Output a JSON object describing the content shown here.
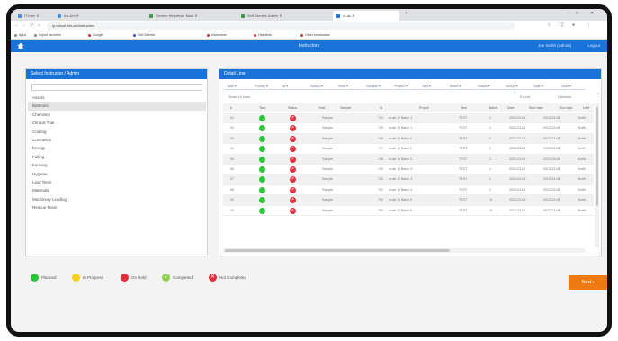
{
  "browser": {
    "tabs": [
      {
        "label": "IT.Instr",
        "color": "#4d8fd6",
        "active": false
      },
      {
        "label": "Ins.Arh",
        "color": "#4d8fd6",
        "active": false
      },
      {
        "label": "Service-Helpdesk: Main",
        "color": "#3c9a4a",
        "active": false
      },
      {
        "label": "Self-Service-Admin",
        "color": "#3c9a4a",
        "active": false
      },
      {
        "label": "eLab",
        "color": "#1a73d9",
        "active": true
      }
    ],
    "new_tab": "+",
    "window_controls": [
      "–",
      "□",
      "✕"
    ],
    "url": "ip.unical.it/eLab/instructors",
    "bookmarks": [
      {
        "label": "Apps",
        "color": "#888888"
      },
      {
        "label": "Import favorites",
        "color": "#888888"
      },
      {
        "label": "Google",
        "color": "#cc3333"
      },
      {
        "label": "Self-Service",
        "color": "#3355cc"
      },
      {
        "label": "Instructors",
        "color": "#cc3333"
      },
      {
        "label": "Helpdesk",
        "color": "#cc3333"
      },
      {
        "label": "Other bookmarks",
        "color": "#cc3333"
      }
    ]
  },
  "app": {
    "title": "Instructors",
    "user": "Joe Smith (Admin)",
    "logout": "Logout"
  },
  "left_panel": {
    "title": "Select Instructor / Admin",
    "select_placeholder": "",
    "items": [
      "Assets",
      "Batteries",
      "Chemistry",
      "Clinical Trial",
      "Coating",
      "Cosmetics",
      "Energy",
      "Falling",
      "Forming",
      "Hygiene",
      "Lipid Tests",
      "Materials",
      "Machinery Leading",
      "Rescue Team"
    ],
    "selected_index": 1
  },
  "right_panel": {
    "title": "Detail Line",
    "filters": [
      "Task",
      "Priority",
      "Id",
      "Status",
      "Hold",
      "Sample",
      "Project",
      "Test",
      "Batch",
      "Status",
      "Group",
      "Date",
      "User"
    ],
    "toolbar": [
      "Show 10 rows",
      "Export",
      "Columns"
    ],
    "columns": [
      "#",
      "Task",
      "Status",
      "Hold",
      "Sample",
      "Id",
      "Project",
      "Test",
      "Batch",
      "Date",
      "Start date",
      "End date",
      "User"
    ],
    "rows": [
      {
        "id": "01",
        "sample": "Sample",
        "num": "744",
        "project": "eLab 1 / Batch 1",
        "test": "TEST",
        "b": "1",
        "start": "2023-03-06",
        "end": "2023-03-08",
        "user": "Smith"
      },
      {
        "id": "02",
        "sample": "Sample",
        "num": "745",
        "project": "eLab 1 / Batch 1",
        "test": "TEST",
        "b": "1",
        "start": "2023-03-06",
        "end": "2023-03-08",
        "user": "Smith"
      },
      {
        "id": "03",
        "sample": "Sample",
        "num": "746",
        "project": "eLab 1 / Batch 2",
        "test": "TEST",
        "b": "1",
        "start": "2023-03-06",
        "end": "2023-03-08",
        "user": "Smith"
      },
      {
        "id": "04",
        "sample": "Sample",
        "num": "747",
        "project": "eLab 1 / Batch 2",
        "test": "TEST",
        "b": "1",
        "start": "2023-03-06",
        "end": "2023-03-08",
        "user": "Smith"
      },
      {
        "id": "05",
        "sample": "Sample",
        "num": "748",
        "project": "eLab 1 / Batch 3",
        "test": "TEST",
        "b": "1",
        "start": "2023-03-06",
        "end": "2023-03-08",
        "user": "Smith"
      },
      {
        "id": "06",
        "sample": "Sample",
        "num": "749",
        "project": "eLab 1 / Batch 3",
        "test": "TEST",
        "b": "1",
        "start": "2023-03-06",
        "end": "2023-03-08",
        "user": "Smith"
      },
      {
        "id": "07",
        "sample": "Sample",
        "num": "750",
        "project": "eLab 1 / Batch 4",
        "test": "TEST",
        "b": "1",
        "start": "2023-03-06",
        "end": "2023-03-08",
        "user": "Smith"
      },
      {
        "id": "08",
        "sample": "Sample",
        "num": "751",
        "project": "eLab 1 / Batch 4",
        "test": "TEST",
        "b": "1",
        "start": "2023-03-06",
        "end": "2023-03-08",
        "user": "Smith"
      },
      {
        "id": "09",
        "sample": "Sample",
        "num": "752",
        "project": "eLab 1 / Batch 5",
        "test": "TEST",
        "b": "11",
        "start": "2023-03-06",
        "end": "2023-03-08",
        "user": "Smith"
      },
      {
        "id": "10",
        "sample": "Sample",
        "num": "753",
        "project": "eLab 1 / Batch 5",
        "test": "TEST",
        "b": "11",
        "start": "2023-03-06",
        "end": "2023-03-08",
        "user": "Smith"
      }
    ]
  },
  "legend": [
    {
      "label": "Planned",
      "color": "#2ec43a",
      "glyph": ""
    },
    {
      "label": "In Progress",
      "color": "#f5d020",
      "glyph": ""
    },
    {
      "label": "On Hold",
      "color": "#e03040",
      "glyph": ""
    },
    {
      "label": "Completed",
      "color": "#8fd14f",
      "glyph": "✓"
    },
    {
      "label": "Not Completed",
      "color": "#e03040",
      "glyph": "✕"
    }
  ],
  "next_button": {
    "label": "Next",
    "arrow": "›",
    "color": "#f07a12"
  }
}
